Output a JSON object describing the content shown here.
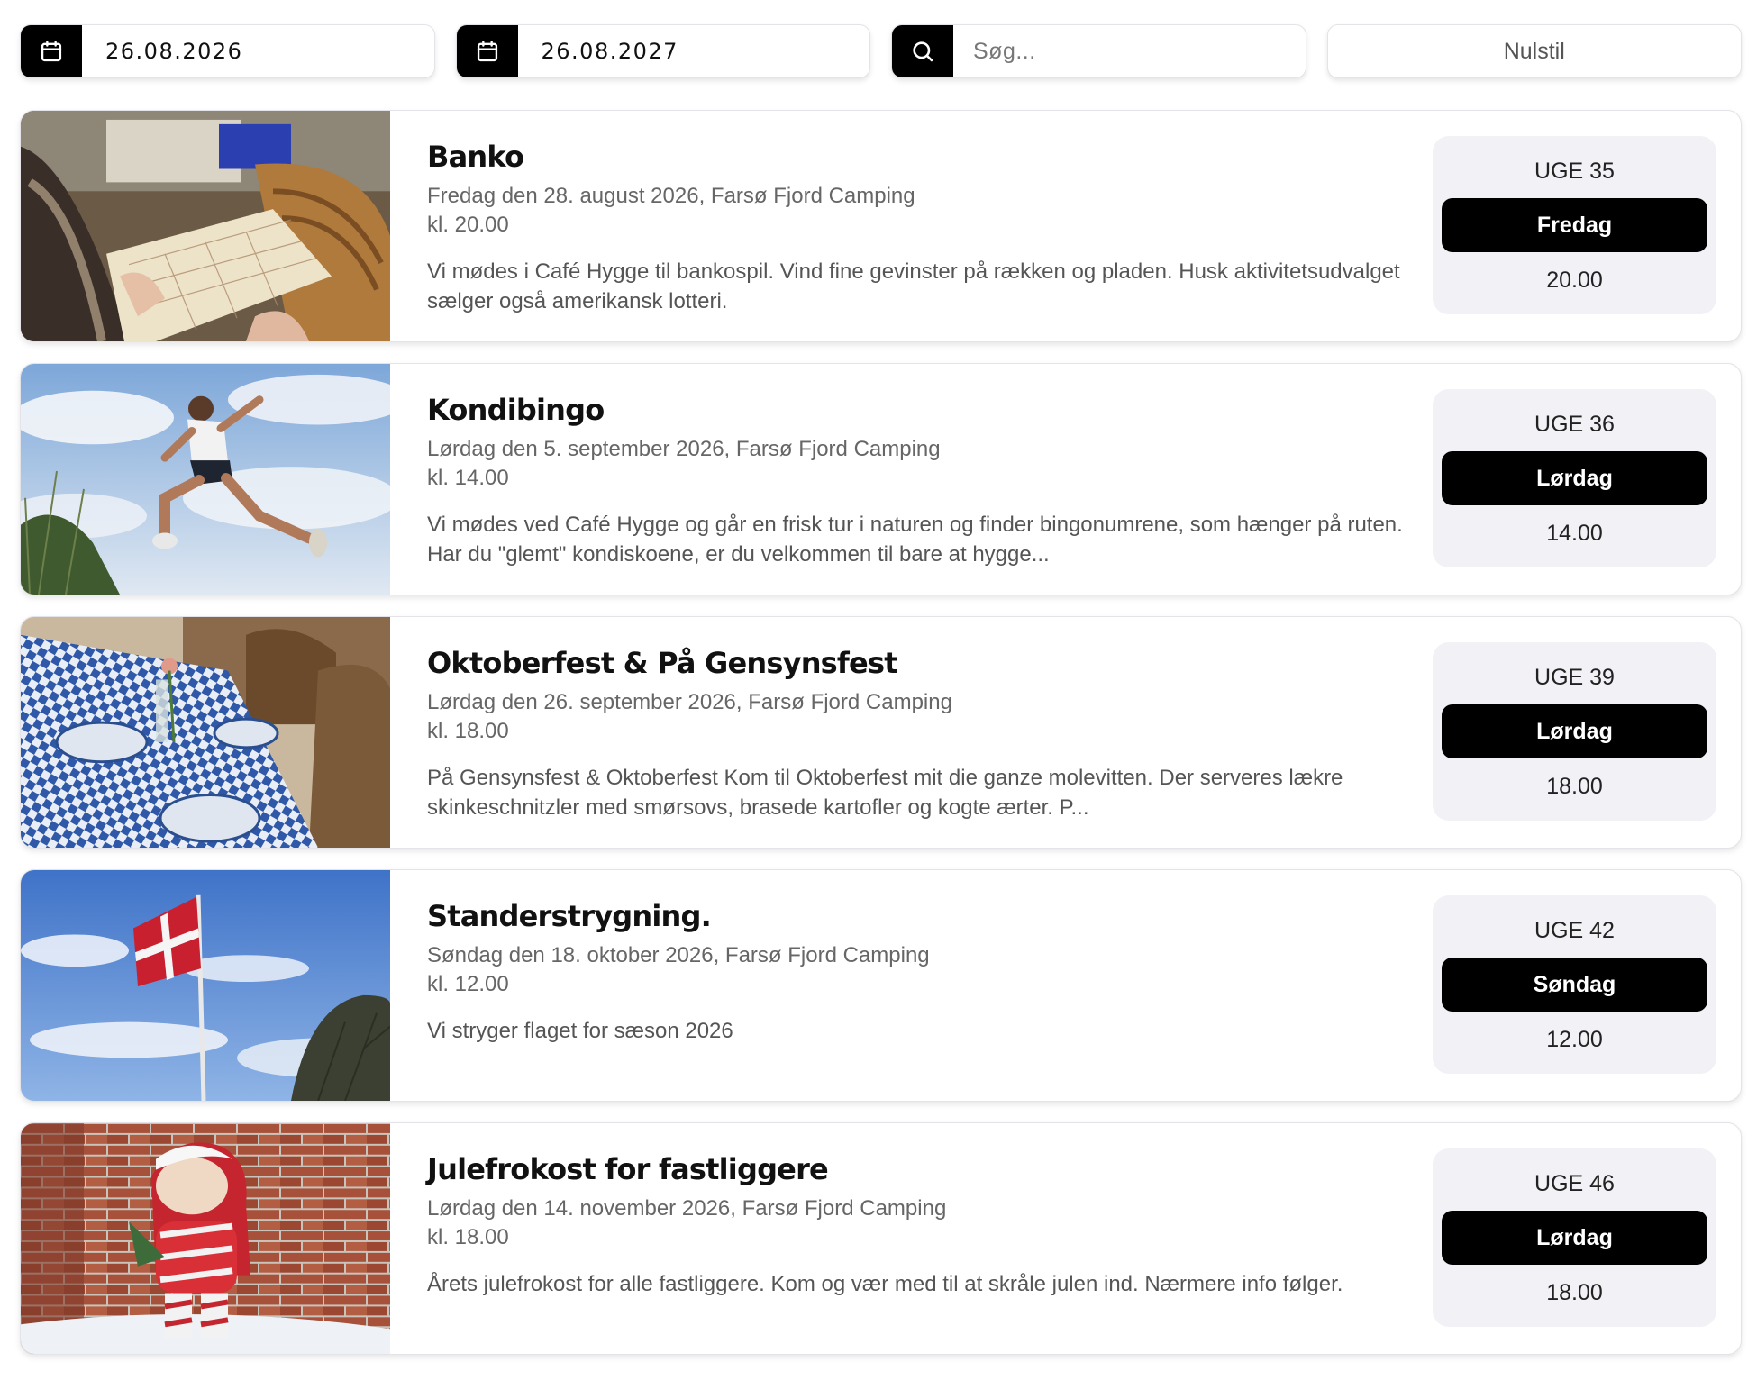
{
  "filters": {
    "from_date": "26.08.2026",
    "to_date": "26.08.2027",
    "search_placeholder": "Søg...",
    "reset_label": "Nulstil",
    "icons": [
      "calendar-icon",
      "calendar-icon",
      "search-icon"
    ]
  },
  "colors": {
    "accent": "#000000",
    "badge_background": "#f1f1f6",
    "muted_text": "#666666"
  },
  "events": [
    {
      "title": "Banko",
      "date_location": "Fredag den 28. august 2026, Farsø Fjord Camping",
      "time": "kl. 20.00",
      "description": "Vi mødes i Café Hygge til bankospil. Vind fine gevinster på rækken og pladen. Husk aktivitetsudvalget sælger også amerikansk lotteri.",
      "week": "UGE 35",
      "day": "Fredag",
      "hour": "20.00",
      "image": "bingo-card-photo"
    },
    {
      "title": "Kondibingo",
      "date_location": "Lørdag den 5. september 2026, Farsø Fjord Camping",
      "time": "kl. 14.00",
      "description": "Vi mødes ved Café Hygge og går en frisk tur i naturen og finder bingonumrene, som hænger på ruten. Har du \"glemt\" kondiskoene, er du velkommen til bare at hygge...",
      "week": "UGE 36",
      "day": "Lørdag",
      "hour": "14.00",
      "image": "jumping-runner-photo"
    },
    {
      "title": "Oktoberfest & På Gensynsfest",
      "date_location": "Lørdag den 26. september 2026, Farsø Fjord Camping",
      "time": "kl. 18.00",
      "description": "På Gensynsfest & Oktoberfest Kom til Oktoberfest mit die ganze molevitten. Der serveres lækre skinkeschnitzler med smørsovs, brasede kartofler og kogte ærter. P...",
      "week": "UGE 39",
      "day": "Lørdag",
      "hour": "18.00",
      "image": "oktoberfest-table-photo"
    },
    {
      "title": "Standerstrygning.",
      "date_location": "Søndag den 18. oktober 2026, Farsø Fjord Camping",
      "time": "kl. 12.00",
      "description": "Vi stryger flaget for sæson 2026",
      "week": "UGE 42",
      "day": "Søndag",
      "hour": "12.00",
      "image": "danish-flag-photo"
    },
    {
      "title": "Julefrokost for fastliggere",
      "date_location": "Lørdag den 14. november 2026, Farsø Fjord Camping",
      "time": "kl. 18.00",
      "description": "Årets julefrokost for alle fastliggere. Kom og vær med til at skråle julen ind. Nærmere info følger.",
      "week": "UGE 46",
      "day": "Lørdag",
      "hour": "18.00",
      "image": "christmas-elf-photo"
    }
  ]
}
